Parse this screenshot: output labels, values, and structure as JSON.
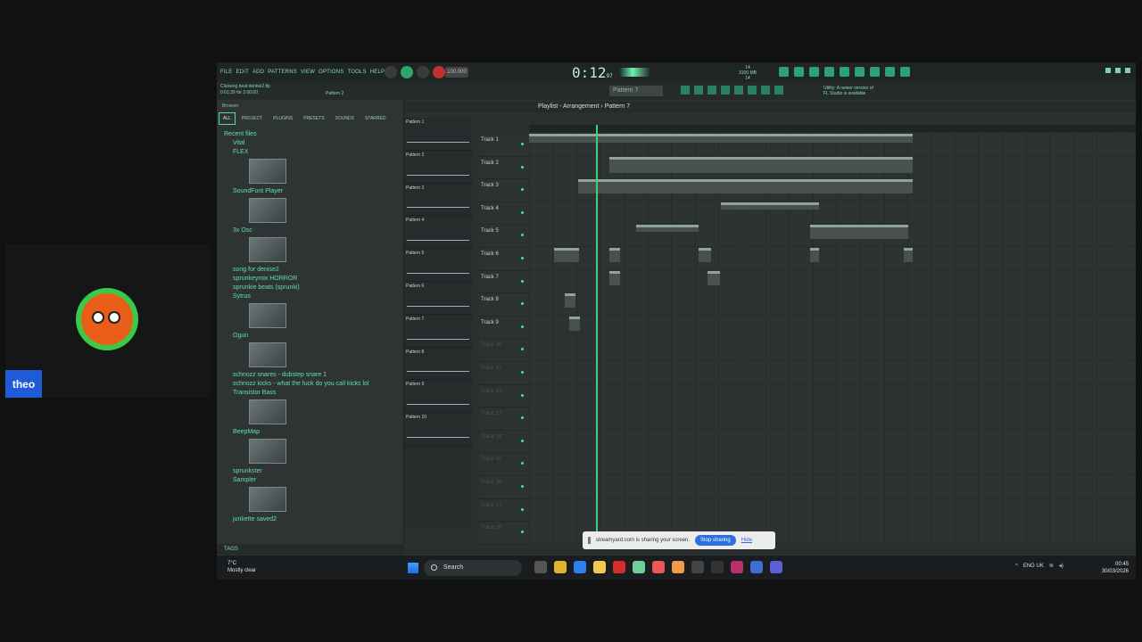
{
  "participant": {
    "name": "theo"
  },
  "app": {
    "menu": [
      "FILE",
      "EDIT",
      "ADD",
      "PATTERNS",
      "VIEW",
      "OPTIONS",
      "TOOLS",
      "HELP"
    ],
    "time": "0:12",
    "time_fraction": "97",
    "tempo": "100.000",
    "cpu": "14\n3100 MB\n14",
    "project": "Clickeng beat denise2.flp",
    "project_sub": "0:01:39 for 2:00:00",
    "pattern_small": "Pattern 2",
    "pattern_selector": "Pattern 7",
    "hint_right": "Utility: A newer version of\nFL Studio is available"
  },
  "browser": {
    "title": "Browser",
    "tabs": [
      "ALL",
      "PROJECT",
      "PLUGINS",
      "PRESETS",
      "SOUNDS",
      "STARRED"
    ],
    "items": [
      {
        "kind": "folder",
        "label": "Recent files"
      },
      {
        "kind": "plugin",
        "label": "Vital"
      },
      {
        "kind": "plugin",
        "label": "FLEX",
        "thumb": true
      },
      {
        "kind": "plugin",
        "label": "SoundFont Player",
        "thumb": true
      },
      {
        "kind": "plugin",
        "label": "3x Osc",
        "thumb": true
      },
      {
        "kind": "file",
        "label": "song for denise2"
      },
      {
        "kind": "file",
        "label": "sprunkeymix HORROR"
      },
      {
        "kind": "file",
        "label": "sprunkie beats (sprunki)"
      },
      {
        "kind": "plugin",
        "label": "Sytrus",
        "thumb": true
      },
      {
        "kind": "plugin",
        "label": "Ogun",
        "thumb": true
      },
      {
        "kind": "file",
        "label": "schnozz snares - dubstep snare 1"
      },
      {
        "kind": "file",
        "label": "schnozz kicks - what the fuck do you call kicks lol"
      },
      {
        "kind": "plugin",
        "label": "Transistor Bass",
        "thumb": true
      },
      {
        "kind": "plugin",
        "label": "BeepMap",
        "thumb": true
      },
      {
        "kind": "file",
        "label": "sprunkster"
      },
      {
        "kind": "plugin",
        "label": "Sampler",
        "thumb": true
      },
      {
        "kind": "file",
        "label": "junkette saved2"
      }
    ],
    "footer": "TAGS"
  },
  "playlist": {
    "title": "Playlist - Arrangement",
    "pattern": "Pattern 7",
    "patterns": [
      "Pattern 1",
      "Pattern 2",
      "Pattern 3",
      "Pattern 4",
      "Pattern 5",
      "Pattern 6",
      "Pattern 7",
      "Pattern 8",
      "Pattern 9",
      "Pattern 10"
    ],
    "tracks": [
      "Track 1",
      "Track 2",
      "Track 3",
      "Track 4",
      "Track 5",
      "Track 6",
      "Track 7",
      "Track 8",
      "Track 9",
      "Track 10",
      "Track 11",
      "Track 12",
      "Track 13",
      "Track 14",
      "Track 15",
      "Track 16",
      "Track 17",
      "Track 18"
    ],
    "active_track_count": 9
  },
  "share": {
    "text": "streamyard.com is sharing your screen.",
    "stop": "Stop sharing",
    "hide": "Hide"
  },
  "taskbar": {
    "weather_temp": "7°C",
    "weather_desc": "Mostly clear",
    "search": "Search",
    "lang": "ENG",
    "region": "UK",
    "time": "00:45",
    "date": "30/03/2026"
  }
}
